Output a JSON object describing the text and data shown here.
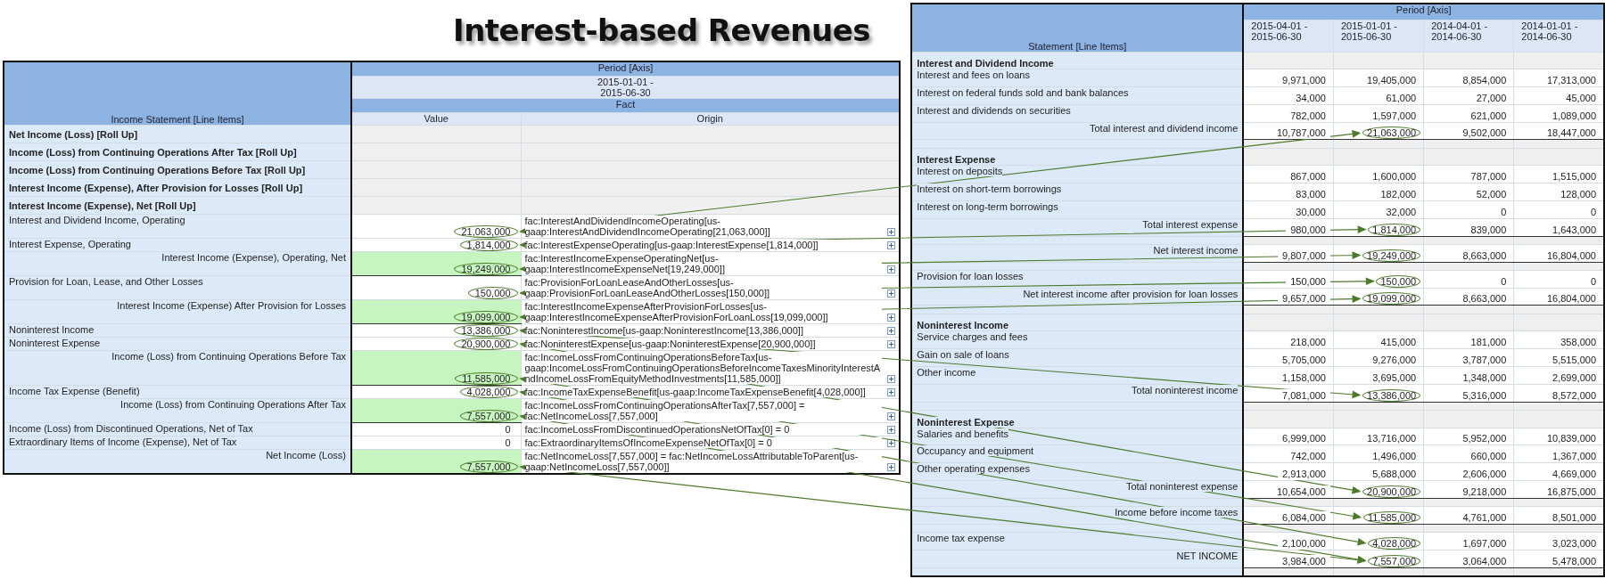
{
  "title": "Interest-based Revenues",
  "income_statement": {
    "line_items_header": "Income Statement [Line Items]",
    "axis_header": "Period [Axis]",
    "period": "2015-01-01 -\n2015-06-30",
    "fact_header": "Fact",
    "value_header": "Value",
    "origin_header": "Origin",
    "rows": [
      {
        "kind": "rollup",
        "label": "Net Income (Loss) [Roll Up]"
      },
      {
        "kind": "rollup",
        "label": "Income (Loss) from Continuing Operations After Tax [Roll Up]"
      },
      {
        "kind": "rollup",
        "label": "Income (Loss) from Continuing Operations Before Tax [Roll Up]"
      },
      {
        "kind": "rollup",
        "label": "Interest Income (Expense), After Provision for Losses [Roll Up]"
      },
      {
        "kind": "rollup",
        "label": "Interest Income (Expense), Net [Roll Up]"
      },
      {
        "kind": "item",
        "label": "Interest and Dividend Income, Operating",
        "value": "21,063,000",
        "circled": true,
        "origin": "fac:InterestAndDividendIncomeOperating[us-gaap:InterestAndDividendIncomeOperating[21,063,000]]"
      },
      {
        "kind": "item",
        "label": "Interest Expense, Operating",
        "value": "1,814,000",
        "circled": true,
        "origin": "fac:InterestExpenseOperating[us-gaap:InterestExpense[1,814,000]]"
      },
      {
        "kind": "total",
        "label": "Interest Income (Expense), Operating, Net",
        "value": "19,249,000",
        "circled": true,
        "origin": "fac:InterestIncomeExpenseOperatingNet[us-gaap:InterestIncomeExpenseNet[19,249,000]]"
      },
      {
        "kind": "item",
        "label": "Provision for Loan, Lease, and Other Losses",
        "value": "150,000",
        "circled": true,
        "origin": "fac:ProvisionForLoanLeaseAndOtherLosses[us-gaap:ProvisionForLoanLeaseAndOtherLosses[150,000]]"
      },
      {
        "kind": "total",
        "label": "Interest Income (Expense) After Provision for Losses",
        "value": "19,099,000",
        "circled": true,
        "origin": "fac:InterestIncomeExpenseAfterProvisionForLosses[us-gaap:InterestIncomeExpenseAfterProvisionForLoanLoss[19,099,000]]"
      },
      {
        "kind": "item",
        "label": "Noninterest Income",
        "value": "13,386,000",
        "circled": true,
        "origin": "fac:NoninterestIncome[us-gaap:NoninterestIncome[13,386,000]]"
      },
      {
        "kind": "item",
        "label": "Noninterest Expense",
        "value": "20,900,000",
        "circled": true,
        "origin": "fac:NoninterestExpense[us-gaap:NoninterestExpense[20,900,000]]"
      },
      {
        "kind": "total",
        "label": "Income (Loss) from Continuing Operations Before Tax",
        "value": "11,585,000",
        "circled": true,
        "origin": "fac:IncomeLossFromContinuingOperationsBeforeTax[us-gaap:IncomeLossFromContinuingOperationsBeforeIncomeTaxesMinorityInterestAndIncomeLossFromEquityMethodInvestments[11,585,000]]"
      },
      {
        "kind": "item",
        "label": "Income Tax Expense (Benefit)",
        "value": "4,028,000",
        "circled": true,
        "origin": "fac:IncomeTaxExpenseBenefit[us-gaap:IncomeTaxExpenseBenefit[4,028,000]]"
      },
      {
        "kind": "total",
        "label": "Income (Loss) from Continuing Operations After Tax",
        "value": "7,557,000",
        "circled": true,
        "origin": "fac:IncomeLossFromContinuingOperationsAfterTax[7,557,000] = fac:NetIncomeLoss[7,557,000]"
      },
      {
        "kind": "item",
        "label": "Income (Loss) from Discontinued Operations, Net of Tax",
        "value": "0",
        "circled": false,
        "origin": "fac:IncomeLossFromDiscontinuedOperationsNetOfTax[0] = 0"
      },
      {
        "kind": "item",
        "label": "Extraordinary Items of Income (Expense), Net of Tax",
        "value": "0",
        "circled": false,
        "origin": "fac:ExtraordinaryItemsOfIncomeExpenseNetOfTax[0] = 0"
      },
      {
        "kind": "total",
        "label": "Net Income (Loss)",
        "value": "7,557,000",
        "circled": true,
        "origin": "fac:NetIncomeLoss[7,557,000] = fac:NetIncomeLossAttributableToParent[us-gaap:NetIncomeLoss[7,557,000]]"
      }
    ]
  },
  "statement": {
    "line_items_header": "Statement [Line Items]",
    "axis_header": "Period [Axis]",
    "periods": [
      "2015-04-01 -\n2015-06-30",
      "2015-01-01 -\n2015-06-30",
      "2014-04-01 -\n2014-06-30",
      "2014-01-01 -\n2014-06-30"
    ],
    "rows": [
      {
        "kind": "section",
        "label": "Interest and Dividend Income"
      },
      {
        "kind": "item",
        "label": "Interest and fees on loans",
        "values": [
          "9,971,000",
          "19,405,000",
          "8,854,000",
          "17,313,000"
        ],
        "circled": [
          false,
          false,
          false,
          false
        ]
      },
      {
        "kind": "item",
        "label": "Interest on federal funds sold and bank balances",
        "values": [
          "34,000",
          "61,000",
          "27,000",
          "45,000"
        ],
        "circled": [
          false,
          false,
          false,
          false
        ]
      },
      {
        "kind": "item",
        "label": "Interest and dividends on securities",
        "values": [
          "782,000",
          "1,597,000",
          "621,000",
          "1,089,000"
        ],
        "circled": [
          false,
          false,
          false,
          false
        ]
      },
      {
        "kind": "total",
        "label": "Total interest and dividend income",
        "values": [
          "10,787,000",
          "21,063,000",
          "9,502,000",
          "18,447,000"
        ],
        "circled": [
          false,
          true,
          false,
          false
        ]
      },
      {
        "kind": "section",
        "label": "Interest Expense"
      },
      {
        "kind": "item",
        "label": "Interest on deposits",
        "values": [
          "867,000",
          "1,600,000",
          "787,000",
          "1,515,000"
        ],
        "circled": [
          false,
          false,
          false,
          false
        ]
      },
      {
        "kind": "item",
        "label": "Interest on short-term borrowings",
        "values": [
          "83,000",
          "182,000",
          "52,000",
          "128,000"
        ],
        "circled": [
          false,
          false,
          false,
          false
        ]
      },
      {
        "kind": "item",
        "label": "Interest on long-term borrowings",
        "values": [
          "30,000",
          "32,000",
          "0",
          "0"
        ],
        "circled": [
          false,
          false,
          false,
          false
        ]
      },
      {
        "kind": "total",
        "label": "Total interest expense",
        "values": [
          "980,000",
          "1,814,000",
          "839,000",
          "1,643,000"
        ],
        "circled": [
          false,
          true,
          false,
          false
        ]
      },
      {
        "kind": "total",
        "label": "Net interest income",
        "values": [
          "9,807,000",
          "19,249,000",
          "8,663,000",
          "16,804,000"
        ],
        "circled": [
          false,
          true,
          false,
          false
        ]
      },
      {
        "kind": "item",
        "label": "Provision for loan losses",
        "values": [
          "150,000",
          "150,000",
          "0",
          "0"
        ],
        "circled": [
          false,
          true,
          false,
          false
        ]
      },
      {
        "kind": "total",
        "label": "Net interest income after provision for loan losses",
        "values": [
          "9,657,000",
          "19,099,000",
          "8,663,000",
          "16,804,000"
        ],
        "circled": [
          false,
          true,
          false,
          false
        ]
      },
      {
        "kind": "section",
        "label": "Noninterest Income"
      },
      {
        "kind": "item",
        "label": "Service charges and fees",
        "values": [
          "218,000",
          "415,000",
          "181,000",
          "358,000"
        ],
        "circled": [
          false,
          false,
          false,
          false
        ]
      },
      {
        "kind": "item",
        "label": "Gain on sale of loans",
        "values": [
          "5,705,000",
          "9,276,000",
          "3,787,000",
          "5,515,000"
        ],
        "circled": [
          false,
          false,
          false,
          false
        ]
      },
      {
        "kind": "item",
        "label": "Other income",
        "values": [
          "1,158,000",
          "3,695,000",
          "1,348,000",
          "2,699,000"
        ],
        "circled": [
          false,
          false,
          false,
          false
        ]
      },
      {
        "kind": "total",
        "label": "Total noninterest income",
        "values": [
          "7,081,000",
          "13,386,000",
          "5,316,000",
          "8,572,000"
        ],
        "circled": [
          false,
          true,
          false,
          false
        ]
      },
      {
        "kind": "section",
        "label": "Noninterest Expense"
      },
      {
        "kind": "item",
        "label": "Salaries and benefits",
        "values": [
          "6,999,000",
          "13,716,000",
          "5,952,000",
          "10,839,000"
        ],
        "circled": [
          false,
          false,
          false,
          false
        ]
      },
      {
        "kind": "item",
        "label": "Occupancy and equipment",
        "values": [
          "742,000",
          "1,496,000",
          "660,000",
          "1,367,000"
        ],
        "circled": [
          false,
          false,
          false,
          false
        ]
      },
      {
        "kind": "item",
        "label": "Other operating expenses",
        "values": [
          "2,913,000",
          "5,688,000",
          "2,606,000",
          "4,669,000"
        ],
        "circled": [
          false,
          false,
          false,
          false
        ]
      },
      {
        "kind": "total",
        "label": "Total noninterest expense",
        "values": [
          "10,654,000",
          "20,900,000",
          "9,218,000",
          "16,875,000"
        ],
        "circled": [
          false,
          true,
          false,
          false
        ]
      },
      {
        "kind": "total",
        "label": "Income before income taxes",
        "values": [
          "6,084,000",
          "11,585,000",
          "4,761,000",
          "8,501,000"
        ],
        "circled": [
          false,
          true,
          false,
          false
        ]
      },
      {
        "kind": "item",
        "label": "Income tax expense",
        "values": [
          "2,100,000",
          "4,028,000",
          "1,697,000",
          "3,023,000"
        ],
        "circled": [
          false,
          true,
          false,
          false
        ]
      },
      {
        "kind": "total",
        "label": "NET INCOME",
        "values": [
          "3,984,000",
          "7,557,000",
          "3,064,000",
          "5,478,000"
        ],
        "circled": [
          false,
          true,
          false,
          false
        ]
      }
    ]
  }
}
